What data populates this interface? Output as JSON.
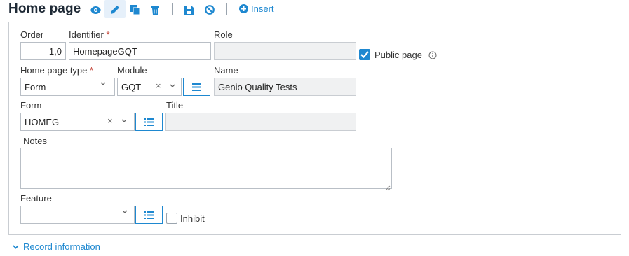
{
  "header": {
    "title": "Home page",
    "insert_label": "Insert"
  },
  "toolbar": {
    "icons": [
      "eye-icon",
      "pencil-icon",
      "copy-icon",
      "trash-icon",
      "save-icon",
      "cancel-icon",
      "plus-circle-icon"
    ]
  },
  "form": {
    "order": {
      "label": "Order",
      "value": "1,0"
    },
    "identifier": {
      "label": "Identifier",
      "required_mark": "*",
      "value": "HomepageGQT"
    },
    "role": {
      "label": "Role",
      "value": ""
    },
    "public_page": {
      "label": "Public page",
      "checked": true
    },
    "home_page_type": {
      "label": "Home page type",
      "required_mark": "*",
      "value": "Form"
    },
    "module": {
      "label": "Module",
      "value": "GQT"
    },
    "name": {
      "label": "Name",
      "value": "Genio Quality Tests"
    },
    "form_field": {
      "label": "Form",
      "value": "HOMEG"
    },
    "title": {
      "label": "Title",
      "value": ""
    },
    "notes": {
      "label": "Notes",
      "value": ""
    },
    "feature": {
      "label": "Feature",
      "value": ""
    },
    "inhibit": {
      "label": "Inhibit",
      "checked": false
    }
  },
  "footer": {
    "record_info_label": "Record information"
  },
  "colors": {
    "accent": "#1e88d0",
    "required": "#c0392b",
    "readonly_bg": "#f0f1f2"
  }
}
